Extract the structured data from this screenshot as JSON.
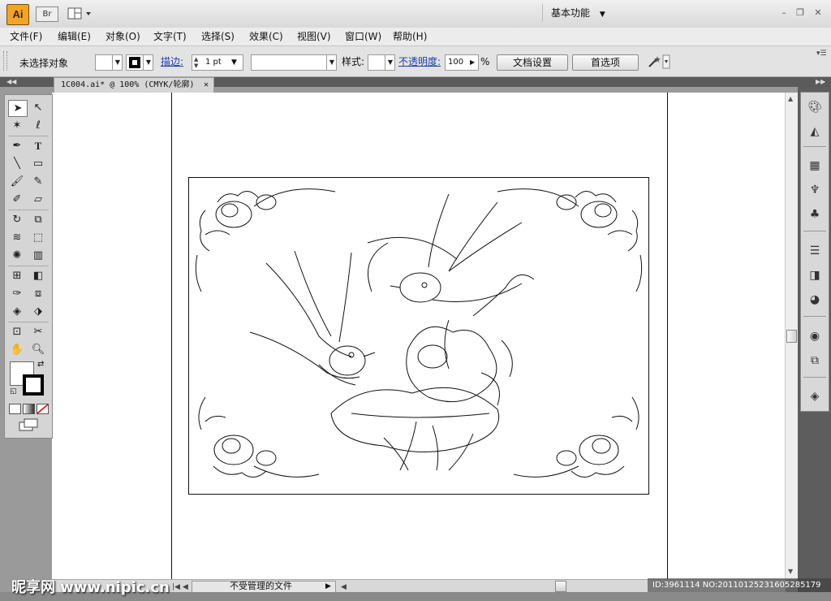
{
  "titlebar": {
    "app_logo": "Ai",
    "bridge_label": "Br",
    "workspace": "基本功能",
    "controls": {
      "minimize": "–",
      "restore": "❐",
      "close": "✕"
    }
  },
  "menubar": {
    "items": [
      {
        "label": "文件(F)"
      },
      {
        "label": "编辑(E)"
      },
      {
        "label": "对象(O)"
      },
      {
        "label": "文字(T)"
      },
      {
        "label": "选择(S)"
      },
      {
        "label": "效果(C)"
      },
      {
        "label": "视图(V)"
      },
      {
        "label": "窗口(W)"
      },
      {
        "label": "帮助(H)"
      }
    ]
  },
  "controlbar": {
    "selection_status": "未选择对象",
    "stroke_label": "描边:",
    "stroke_weight": "1 pt",
    "style_label": "样式:",
    "opacity_label": "不透明度:",
    "opacity_value": "100",
    "percent": "%",
    "doc_setup_button": "文档设置",
    "preferences_button": "首选项"
  },
  "document": {
    "tab_title": "1C004.ai* @ 100% (CMYK/轮廓)",
    "close_glyph": "✕"
  },
  "statusbar": {
    "status_text": "不受管理的文件"
  },
  "watermark": {
    "left": "昵享网 www.nipic.cn",
    "right": "ID:3961114 NO:20110125231605285179"
  },
  "colors": {
    "logo_bg": "#f1a526",
    "link_blue": "#1b3fa8",
    "dock_gray": "#5d5d5d"
  }
}
